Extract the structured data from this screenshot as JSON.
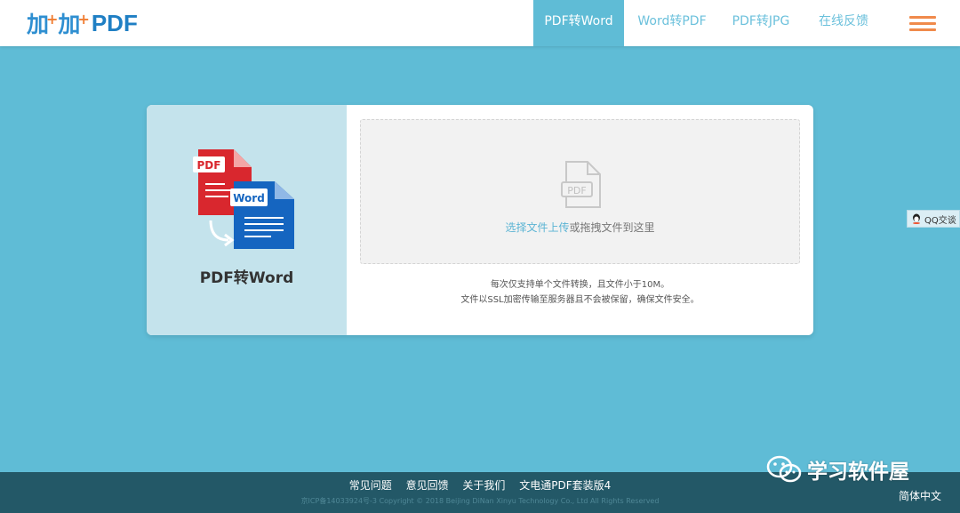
{
  "header": {
    "logo_text": "PDF",
    "nav": [
      {
        "label": "PDF转Word",
        "active": true
      },
      {
        "label": "Word转PDF",
        "active": false
      },
      {
        "label": "PDF转JPG",
        "active": false
      },
      {
        "label": "在线反馈",
        "active": false
      }
    ],
    "menu_icon": "hamburger-icon"
  },
  "card": {
    "title": "PDF转Word",
    "icon_pdf_label": "PDF",
    "icon_word_label": "Word",
    "dropzone": {
      "file_icon_label": "PDF",
      "link_text": "选择文件上传",
      "text": "或拖拽文件到这里"
    },
    "notes": [
      "每次仅支持单个文件转换，且文件小于10M。",
      "文件以SSL加密传输至服务器且不会被保留，确保文件安全。"
    ]
  },
  "qq": {
    "label": "QQ交谈"
  },
  "footer": {
    "links": [
      "常见问题",
      "意见回馈",
      "关于我们",
      "文电通PDF套装版4"
    ],
    "copyright": "京ICP备14033924号-3 Copyright © 2018 Beijing DiNan Xinyu Technology Co., Ltd All Rights Reserved",
    "language": "简体中文"
  },
  "watermark": {
    "name": "学习软件屋"
  },
  "colors": {
    "accent": "#5fbcd6",
    "footer": "#235867",
    "menu": "#f08a4b",
    "pdf_red": "#d9272e",
    "word_blue": "#1565c0"
  }
}
